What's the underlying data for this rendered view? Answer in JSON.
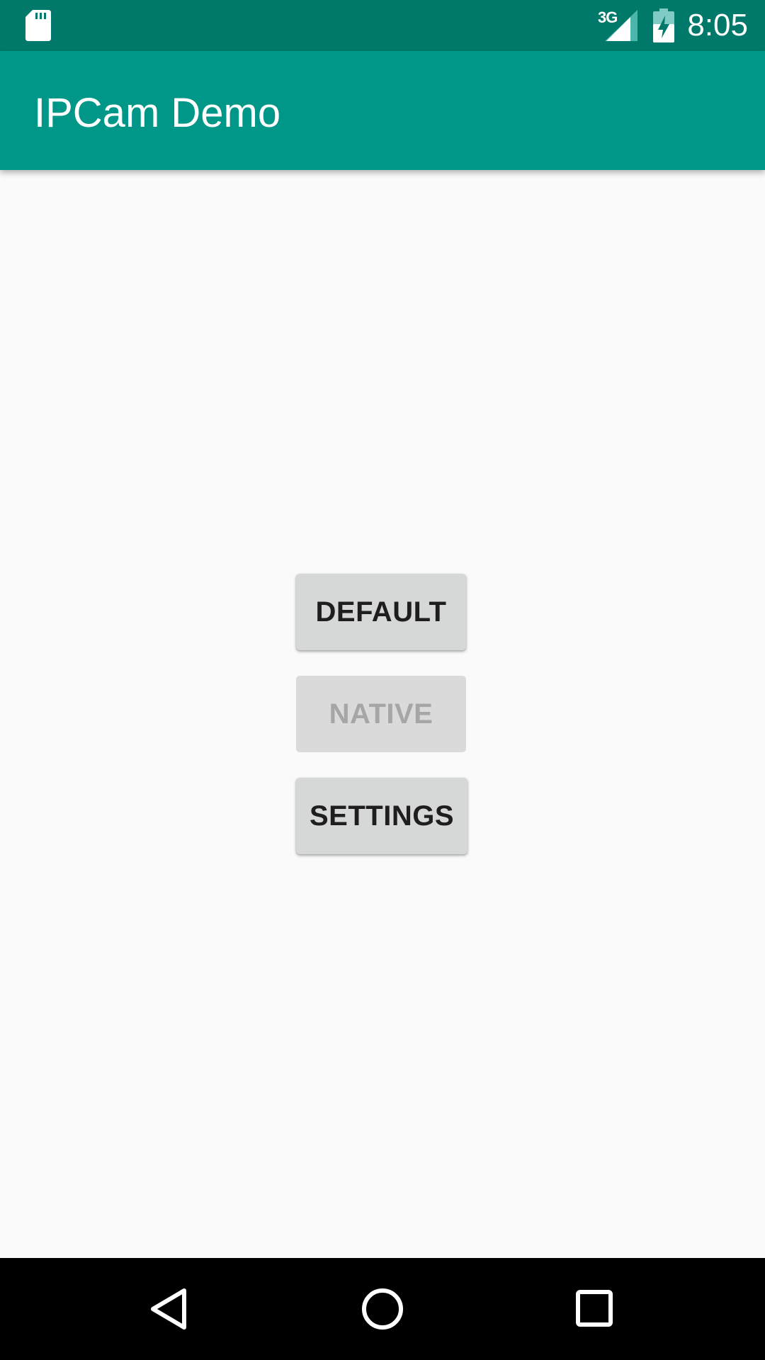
{
  "status_bar": {
    "network": "3G",
    "time": "8:05",
    "icons": [
      "sd-card-icon",
      "signal-icon",
      "battery-charging-icon"
    ]
  },
  "app_bar": {
    "title": "IPCam Demo"
  },
  "buttons": {
    "default_label": "DEFAULT",
    "native_label": "NATIVE",
    "settings_label": "SETTINGS"
  },
  "nav_bar": {
    "icons": [
      "back-icon",
      "home-icon",
      "recents-icon"
    ]
  },
  "colors": {
    "status_bar": "#00796b",
    "app_bar": "#009688",
    "background": "#fafafa",
    "button": "#d6d7d7",
    "button_text": "#1e1e1e",
    "button_disabled_text": "#a6a6a6"
  }
}
